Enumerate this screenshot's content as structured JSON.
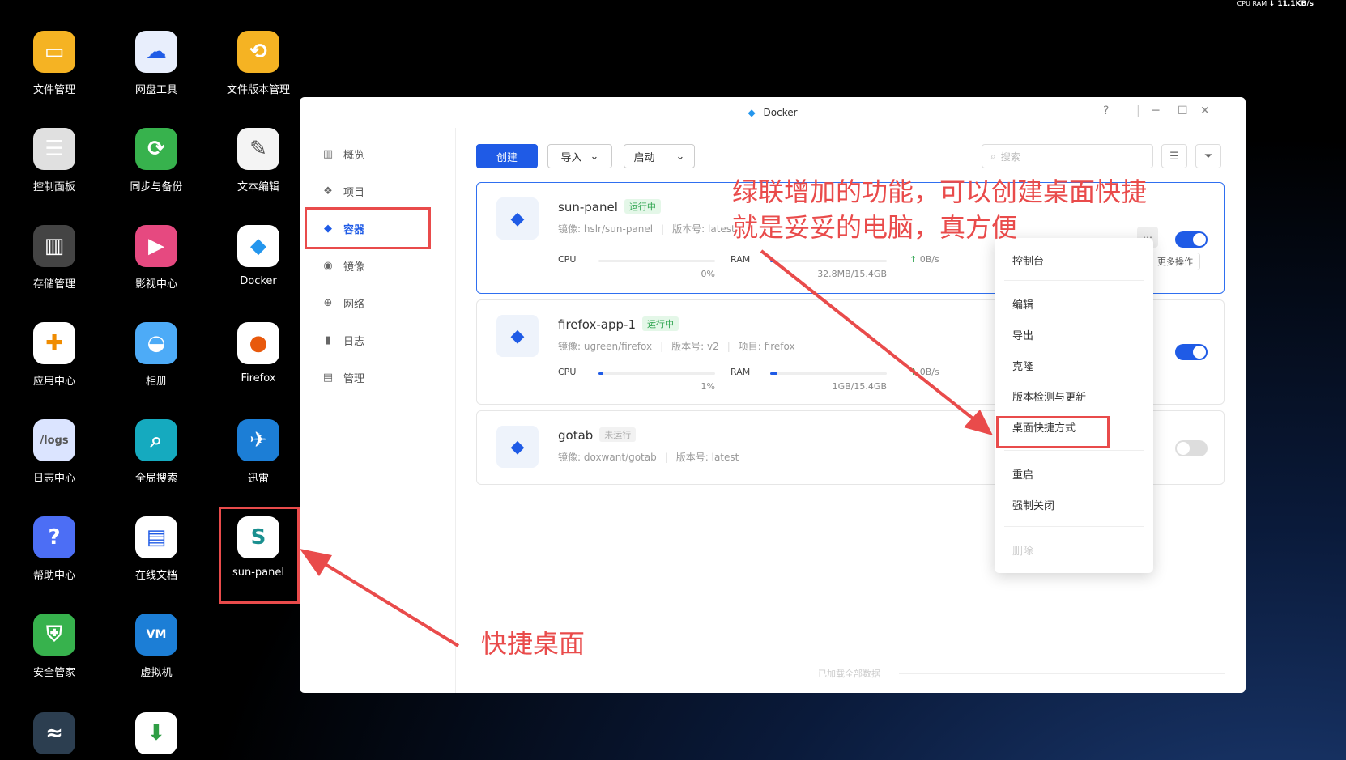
{
  "colors": {
    "accent": "#1f5be6",
    "annotation": "#e94b4b",
    "running": "#2ea44f"
  },
  "desktop": {
    "icons": [
      {
        "label": "文件管理",
        "icon": "folder-icon",
        "bg": "#f5b323"
      },
      {
        "label": "网盘工具",
        "icon": "cloud-drive-icon",
        "bg": "#e8eefc"
      },
      {
        "label": "文件版本管理",
        "icon": "file-version-icon",
        "bg": "#f5b323"
      },
      {
        "label": "控制面板",
        "icon": "control-panel-icon",
        "bg": "#e0e0e0"
      },
      {
        "label": "同步与备份",
        "icon": "sync-icon",
        "bg": "#37b24d"
      },
      {
        "label": "文本编辑",
        "icon": "text-edit-icon",
        "bg": "#f4f4f4"
      },
      {
        "label": "存储管理",
        "icon": "storage-icon",
        "bg": "#444444"
      },
      {
        "label": "影视中心",
        "icon": "video-icon",
        "bg": "#e64980"
      },
      {
        "label": "Docker",
        "icon": "docker-icon",
        "bg": "#ffffff"
      },
      {
        "label": "应用中心",
        "icon": "app-center-icon",
        "bg": "#ffffff"
      },
      {
        "label": "相册",
        "icon": "photo-icon",
        "bg": "#4dabf7"
      },
      {
        "label": "Firefox",
        "icon": "firefox-icon",
        "bg": "#ffffff"
      },
      {
        "label": "日志中心",
        "icon": "logs-icon",
        "bg": "#dbe4ff"
      },
      {
        "label": "全局搜索",
        "icon": "search-icon",
        "bg": "#15aabf"
      },
      {
        "label": "迅雷",
        "icon": "thunder-icon",
        "bg": "#1c7ed6"
      },
      {
        "label": "帮助中心",
        "icon": "help-icon",
        "bg": "#4c6ef5"
      },
      {
        "label": "在线文档",
        "icon": "doc-icon",
        "bg": "#ffffff"
      },
      {
        "label": "sun-panel",
        "icon": "sun-panel-icon",
        "bg": "#ffffff"
      },
      {
        "label": "安全管家",
        "icon": "shield-icon",
        "bg": "#37b24d"
      },
      {
        "label": "虚拟机",
        "icon": "vm-icon",
        "bg": "#1c7ed6"
      }
    ],
    "icon_glyphs": {
      "logs": "/logs",
      "sun": "S",
      "vm": "VM"
    }
  },
  "window": {
    "title": "Docker",
    "help": "?",
    "sidebar": [
      "概览",
      "项目",
      "容器",
      "镜像",
      "网络",
      "日志",
      "管理"
    ],
    "toolbar": {
      "create": "创建",
      "import": "导入",
      "start": "启动",
      "search_placeholder": "搜索"
    },
    "containers": [
      {
        "name": "sun-panel",
        "status": "运行中",
        "image": "镜像: hslr/sun-panel",
        "version": "版本号: latest",
        "project": "",
        "cpu_label": "CPU",
        "cpu_value": "0%",
        "cpu_fraction": 0.0,
        "ram_label": "RAM",
        "ram_value": "32.8MB/15.4GB",
        "ram_fraction": 0.002,
        "net": "0B/s",
        "enabled": true
      },
      {
        "name": "firefox-app-1",
        "status": "运行中",
        "image": "镜像: ugreen/firefox",
        "version": "版本号: v2",
        "project": "项目: firefox",
        "cpu_label": "CPU",
        "cpu_value": "1%",
        "cpu_fraction": 0.01,
        "ram_label": "RAM",
        "ram_value": "1GB/15.4GB",
        "ram_fraction": 0.065,
        "net": "0B/s",
        "enabled": true
      },
      {
        "name": "gotab",
        "status": "未运行",
        "image": "镜像: doxwant/gotab",
        "version": "版本号: latest",
        "project": "",
        "enabled": false
      }
    ],
    "context_menu": [
      "控制台",
      "编辑",
      "导出",
      "克隆",
      "版本检测与更新",
      "桌面快捷方式",
      "重启",
      "强制关闭",
      "删除"
    ],
    "more_tooltip": "更多操作",
    "footer": "已加载全部数据"
  },
  "annotations": {
    "title_line1": "绿联增加的功能，可以创建桌面快捷",
    "title_line2": "就是妥妥的电脑，真方便",
    "shortcut": "快捷桌面"
  },
  "status_bar": {
    "cpu": "CPU",
    "ram": "RAM",
    "net": "↓ 11.1KB/s"
  }
}
